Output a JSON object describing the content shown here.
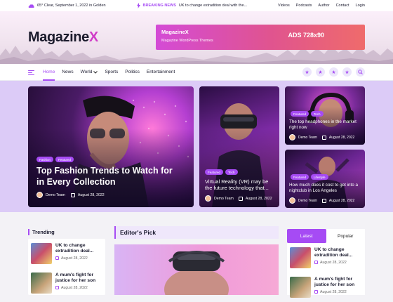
{
  "topbar": {
    "weather": "65° Clear, September 1, 2022 in Golden",
    "breaking_label": "BREAKING NEWS",
    "breaking_text": "UK to change extradition deal with the...",
    "links": [
      "Videos",
      "Podcasts",
      "Author",
      "Contact",
      "Login"
    ]
  },
  "brand": {
    "logo_main": "Magazine",
    "logo_x": "X"
  },
  "ad": {
    "title": "MagazineX",
    "subtitle": "Magazine WordPress Themes",
    "size": "ADS 728x90"
  },
  "nav": {
    "items": [
      "Home",
      "News",
      "World",
      "Sports",
      "Politics",
      "Entertainment"
    ],
    "active": "Home"
  },
  "featured": {
    "main": {
      "tags": [
        "Fashion",
        "Featured"
      ],
      "title": "Top Fashion Trends to Watch for in Every Collection",
      "author": "Demo Team",
      "date": "August 28, 2022"
    },
    "middle": {
      "tags": [
        "Featured",
        "Tech"
      ],
      "title": "Virtual Reality (VR) may be the future technology that...",
      "author": "Demo Team",
      "date": "August 28, 2022"
    },
    "right_top": {
      "tags": [
        "Featured",
        "Tech"
      ],
      "title": "The top headphones in the market right now",
      "author": "Demo Team",
      "date": "August 28, 2022"
    },
    "right_bottom": {
      "tags": [
        "Featured",
        "Lifestyle"
      ],
      "title": "How much does it cost to get into a nightclub in Los Angeles",
      "author": "Demo Team",
      "date": "August 28, 2022"
    }
  },
  "trending": {
    "title": "Trending",
    "items": [
      {
        "title": "UK to change extradition deal...",
        "date": "August 28, 2022"
      },
      {
        "title": "A mum's fight for justice for her son",
        "date": "August 28, 2022"
      }
    ]
  },
  "editor": {
    "title": "Editor's Pick"
  },
  "popular": {
    "tabs": [
      "Latest",
      "Popular"
    ],
    "active": "Latest",
    "items": [
      {
        "title": "UK to change extradition deal...",
        "date": "August 28, 2022"
      },
      {
        "title": "A mum's fight for justice for her son",
        "date": "August 28, 2022"
      }
    ]
  },
  "colors": {
    "accent": "#a64bf4",
    "band": "#dccbf7"
  }
}
